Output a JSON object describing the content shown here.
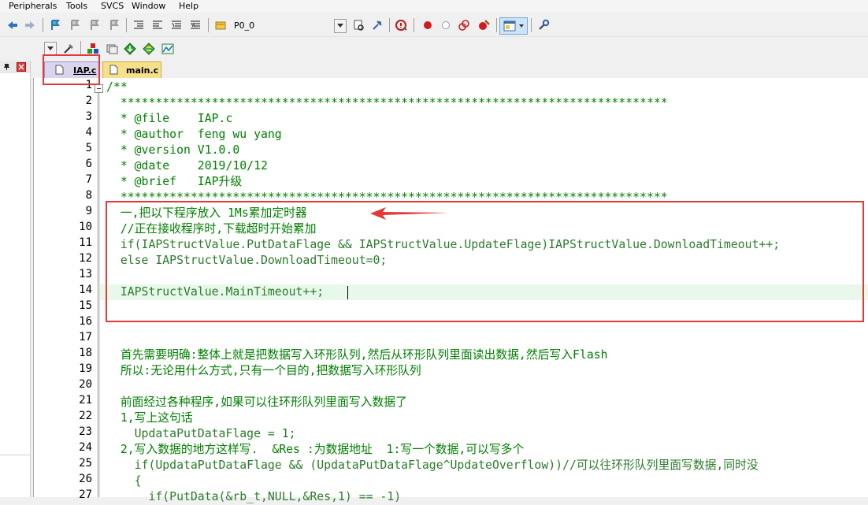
{
  "menu": [
    "Peripherals",
    "Tools",
    "SVCS",
    "Window",
    "Help"
  ],
  "toolbar": {
    "target_value": "P0_0"
  },
  "tabs": [
    {
      "label": "IAP.c",
      "active": true
    },
    {
      "label": "main.c",
      "active": false
    }
  ],
  "editor": {
    "line_numbers": [
      "1",
      "2",
      "3",
      "4",
      "5",
      "6",
      "7",
      "8",
      "9",
      "10",
      "11",
      "12",
      "13",
      "14",
      "15",
      "16",
      "17",
      "18",
      "19",
      "20",
      "21",
      "22",
      "23",
      "24",
      "25",
      "26",
      "27"
    ],
    "lines": [
      "/**",
      "  ******************************************************************************",
      "  * @file    IAP.c",
      "  * @author  feng wu yang",
      "  * @version V1.0.0",
      "  * @date    2019/10/12",
      "  * @brief   IAP升级",
      "  ******************************************************************************",
      "  一,把以下程序放入 1Ms累加定时器",
      "  //正在接收程序时,下载超时开始累加",
      "  if(IAPStructValue.PutDataFlage && IAPStructValue.UpdateFlage)IAPStructValue.DownloadTimeout++;",
      "  else IAPStructValue.DownloadTimeout=0;",
      "",
      "  IAPStructValue.MainTimeout++;",
      "",
      "",
      "",
      "  首先需要明确:整体上就是把数据写入环形队列,然后从环形队列里面读出数据,然后写入Flash",
      "  所以:无论用什么方式,只有一个目的,把数据写入环形队列",
      "",
      "  前面经过各种程序,如果可以往环形队列里面写入数据了",
      "  1,写上这句话",
      "    UpdataPutDataFlage = 1;",
      "  2,写入数据的地方这样写.  &Res :为数据地址  1:写一个数据,可以写多个",
      "    if(UpdataPutDataFlage && (UpdataPutDataFlage^UpdateOverflow))//可以往环形队列里面写数据,同时没",
      "    {",
      "      if(PutData(&rb_t,NULL,&Res,1) == -1)"
    ]
  },
  "colors": {
    "annotation": "#e53935",
    "current_line": "#e8f8ea"
  }
}
